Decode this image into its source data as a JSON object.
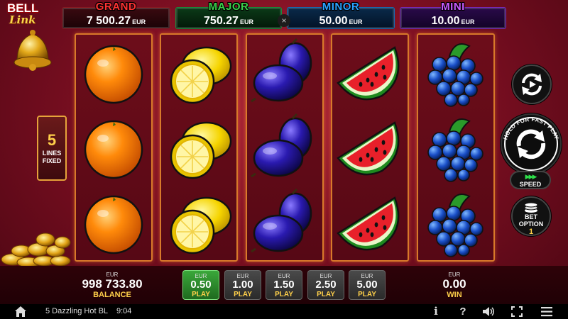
{
  "logo": {
    "line1": "BELL",
    "line2": "Link",
    "coins_text": "BELL Link"
  },
  "jackpots": {
    "grand": {
      "name": "GRAND",
      "value": "7 500.27",
      "currency": "EUR",
      "color": "#ff3232"
    },
    "major": {
      "name": "MAJOR",
      "value": "750.27",
      "currency": "EUR",
      "color": "#3bd14a"
    },
    "minor": {
      "name": "MINOR",
      "value": "50.00",
      "currency": "EUR",
      "color": "#2aa2ff"
    },
    "mini": {
      "name": "MINI",
      "value": "10.00",
      "currency": "EUR",
      "color": "#c95bff"
    },
    "close_glyph": "×"
  },
  "reels": [
    [
      "orange",
      "orange",
      "orange"
    ],
    [
      "lemon",
      "lemon",
      "lemon"
    ],
    [
      "plum",
      "plum",
      "plum"
    ],
    [
      "watermelon",
      "watermelon",
      "watermelon"
    ],
    [
      "grapes",
      "grapes",
      "grapes"
    ]
  ],
  "lines": {
    "count": "5",
    "label1": "LINES",
    "label2": "FIXED"
  },
  "controls": {
    "autoplay_icon": "autoplay-icon",
    "spin_hint": "HOLD FOR FAST PLAY",
    "speed_label": "SPEED",
    "speed_glyph": "▶▶▶",
    "bet_option_label1": "BET",
    "bet_option_label2": "OPTION",
    "bet_option_value": "1"
  },
  "balance": {
    "currency": "EUR",
    "value": "998 733.80",
    "label": "BALANCE"
  },
  "win": {
    "currency": "EUR",
    "value": "0.00",
    "label": "WIN"
  },
  "bets": [
    {
      "currency": "EUR",
      "value": "0.50",
      "label": "PLAY",
      "active": true
    },
    {
      "currency": "EUR",
      "value": "1.00",
      "label": "PLAY",
      "active": false
    },
    {
      "currency": "EUR",
      "value": "1.50",
      "label": "PLAY",
      "active": false
    },
    {
      "currency": "EUR",
      "value": "2.50",
      "label": "PLAY",
      "active": false
    },
    {
      "currency": "EUR",
      "value": "5.00",
      "label": "PLAY",
      "active": false
    }
  ],
  "status_bar": {
    "game_name": "5 Dazzling Hot BL",
    "time": "9:04",
    "info_glyph": "i",
    "help_glyph": "?",
    "icons": [
      "home-icon",
      "info-icon",
      "help-icon",
      "sound-icon",
      "fullscreen-icon",
      "menu-icon"
    ]
  },
  "colors": {
    "background": "#7d0f22",
    "reel_border": "#d8792a",
    "accent_yellow": "#ffd04a",
    "active_bet": "#3aa83a"
  }
}
